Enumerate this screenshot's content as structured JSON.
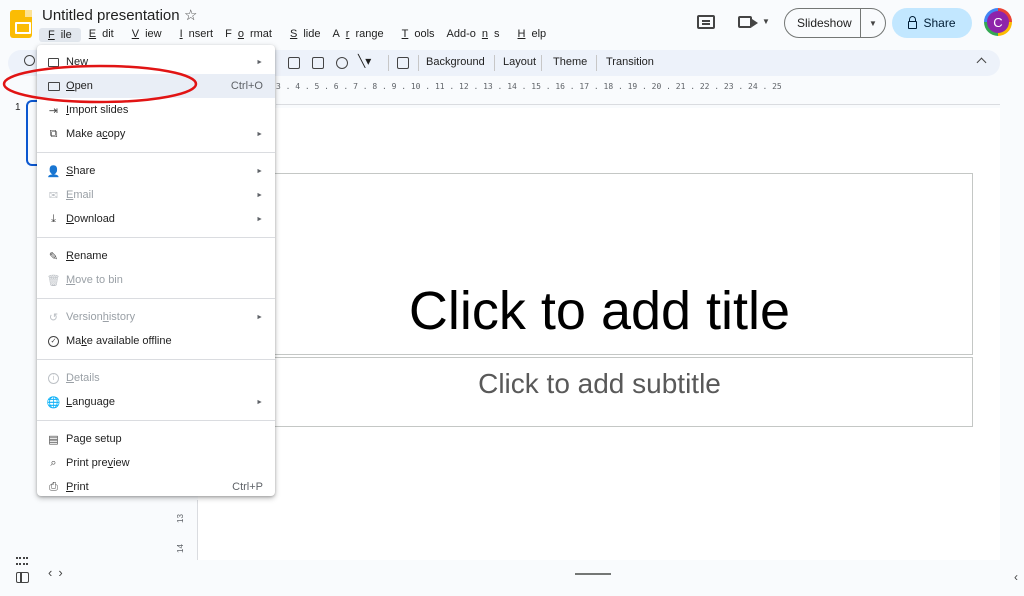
{
  "header": {
    "doc_title": "Untitled presentation",
    "menu": [
      {
        "pre": "",
        "ul": "F",
        "post": "ile"
      },
      {
        "pre": "",
        "ul": "E",
        "post": "dit"
      },
      {
        "pre": "",
        "ul": "V",
        "post": "iew"
      },
      {
        "pre": "",
        "ul": "I",
        "post": "nsert"
      },
      {
        "pre": "F",
        "ul": "o",
        "post": "rmat"
      },
      {
        "pre": "",
        "ul": "S",
        "post": "lide"
      },
      {
        "pre": "A",
        "ul": "r",
        "post": "range"
      },
      {
        "pre": "",
        "ul": "T",
        "post": "ools"
      },
      {
        "pre": "Add-o",
        "ul": "n",
        "post": "s"
      },
      {
        "pre": "",
        "ul": "H",
        "post": "elp"
      }
    ],
    "slideshow_label": "Slideshow",
    "share_label": "Share",
    "avatar_initial": "C"
  },
  "toolbar": {
    "background": "Background",
    "layout": "Layout",
    "theme": "Theme",
    "transition": "Transition"
  },
  "ruler": {
    "ticks": "3 . 4 . 5 . 6 . 7 . 8 . 9 . 10 . 11 . 12 . 13 . 14 . 15 . 16 . 17 . 18 . 19 . 20 . 21 . 22 . 23 . 24 . 25",
    "v_ticks": [
      "13",
      "14"
    ]
  },
  "filmstrip": {
    "slide_number": "1"
  },
  "slide": {
    "title_placeholder": "Click to add title",
    "subtitle_placeholder": "Click to add subtitle"
  },
  "file_menu": {
    "items": [
      {
        "pre": "",
        "ul": "N",
        "post": "ew",
        "icon": "new-slide-icon",
        "submenu": true
      },
      {
        "pre": "",
        "ul": "O",
        "post": "pen",
        "icon": "folder-icon",
        "shortcut": "Ctrl+O",
        "hover": true
      },
      {
        "pre": "",
        "ul": "I",
        "post": "mport slides",
        "icon": "import-icon"
      },
      {
        "pre": "Make a ",
        "ul": "c",
        "post": "opy",
        "icon": "copy-icon",
        "submenu": true
      },
      {
        "pre": "",
        "ul": "S",
        "post": "hare",
        "icon": "share-person-icon",
        "submenu": true
      },
      {
        "pre": "",
        "ul": "E",
        "post": "mail",
        "icon": "email-icon",
        "submenu": true,
        "disabled": true
      },
      {
        "pre": "",
        "ul": "D",
        "post": "ownload",
        "icon": "download-icon",
        "submenu": true
      },
      {
        "pre": "",
        "ul": "R",
        "post": "ename",
        "icon": "rename-icon"
      },
      {
        "pre": "",
        "ul": "M",
        "post": "ove to bin",
        "icon": "trash-icon",
        "disabled": true
      },
      {
        "pre": "Version ",
        "ul": "h",
        "post": "istory",
        "icon": "history-icon",
        "submenu": true,
        "disabled": true
      },
      {
        "pre": "Ma",
        "ul": "k",
        "post": "e available offline",
        "icon": "offline-icon"
      },
      {
        "pre": "",
        "ul": "D",
        "post": "etails",
        "icon": "info-icon",
        "disabled": true
      },
      {
        "pre": "",
        "ul": "L",
        "post": "anguage",
        "icon": "globe-icon",
        "submenu": true
      },
      {
        "pre": "Pa",
        "ul": "g",
        "post": "e setup",
        "icon": "page-setup-icon"
      },
      {
        "pre": "Print pre",
        "ul": "v",
        "post": "iew",
        "icon": "print-preview-icon"
      },
      {
        "pre": "",
        "ul": "P",
        "post": "rint",
        "icon": "printer-icon",
        "shortcut": "Ctrl+P"
      }
    ]
  },
  "colors": {
    "annotation_red": "#e11414",
    "selection_blue": "#0b57d0",
    "share_bg": "#c2e7ff",
    "logo_yellow": "#fbbc04"
  }
}
